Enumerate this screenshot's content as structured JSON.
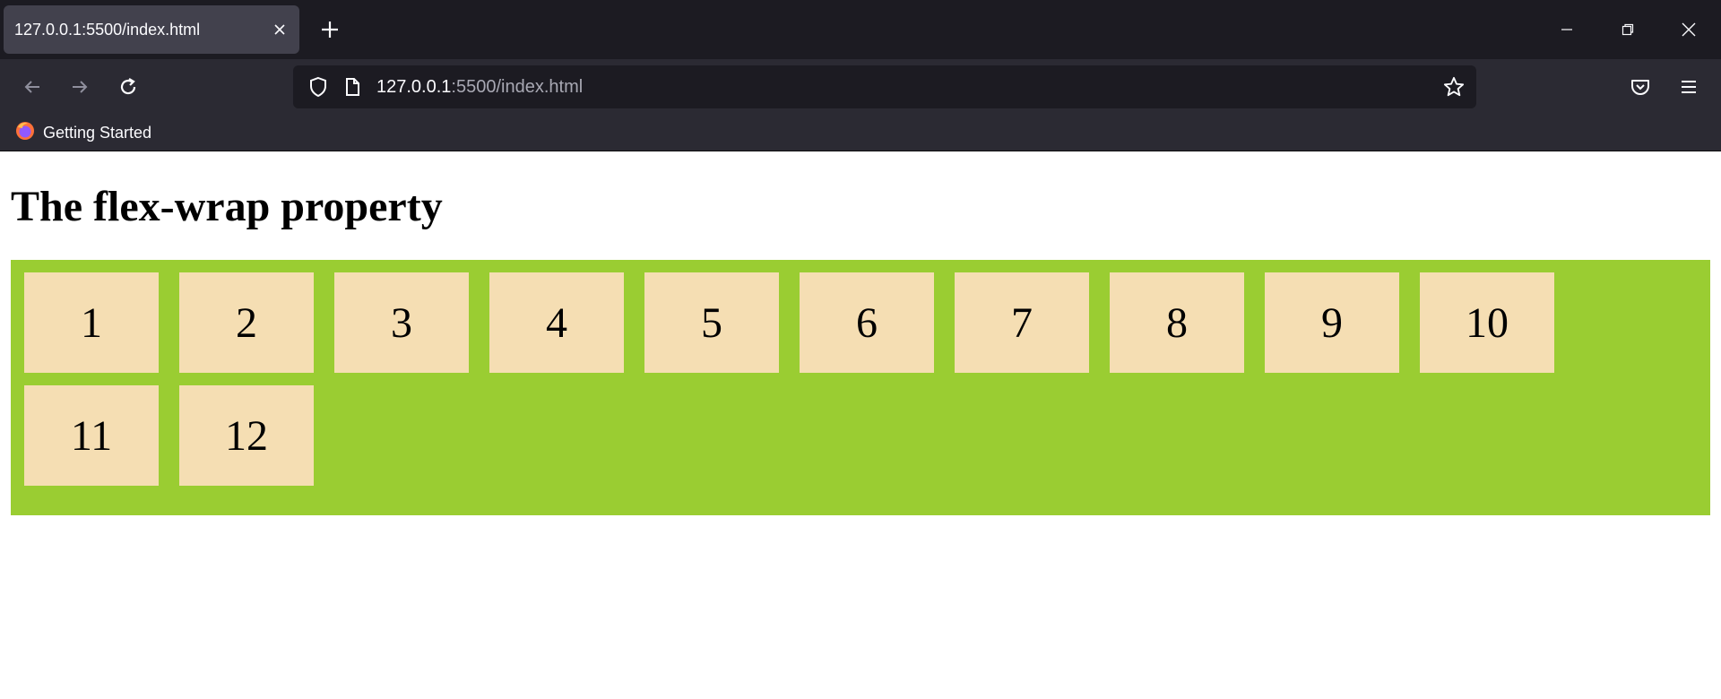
{
  "browser": {
    "tab": {
      "title": "127.0.0.1:5500/index.html"
    },
    "address_bar": {
      "host": "127.0.0.1",
      "rest": ":5500/index.html"
    },
    "bookmarks": [
      {
        "label": "Getting Started"
      }
    ],
    "colors": {
      "tabstrip": "#1c1b22",
      "toolbar": "#2b2a33",
      "active_tab": "#42414d",
      "text": "#fbfbfe"
    }
  },
  "page": {
    "title": "The flex-wrap property",
    "container_color": "#9acd32",
    "item_color": "#f5deb3",
    "items": [
      "1",
      "2",
      "3",
      "4",
      "5",
      "6",
      "7",
      "8",
      "9",
      "10",
      "11",
      "12"
    ]
  }
}
